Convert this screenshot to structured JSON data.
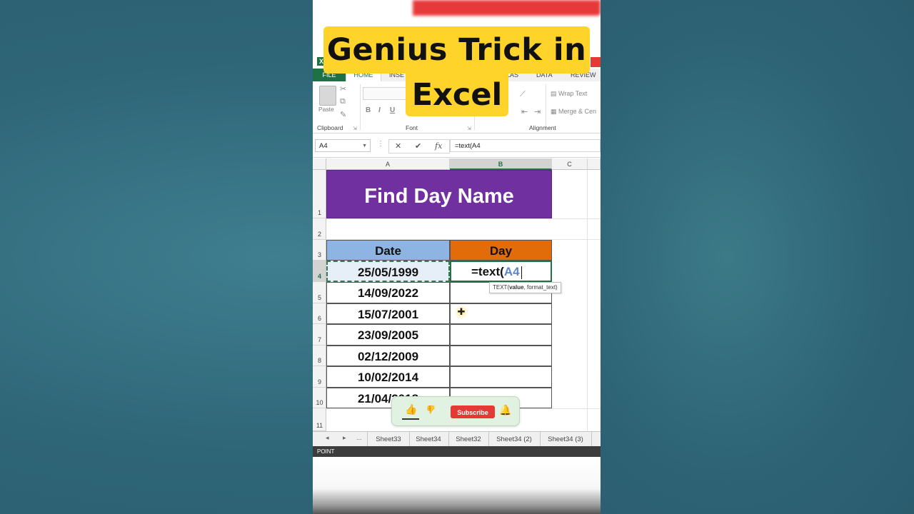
{
  "title": {
    "line1": "Genius Trick in",
    "line2": "Excel"
  },
  "excel": {
    "ribbon_tabs": [
      "FILE",
      "HOME",
      "INSE",
      "LAS",
      "DATA",
      "REVIEW"
    ],
    "ribbon": {
      "paste_label": "Paste",
      "clipboard_label": "Clipboard",
      "font_label": "Font",
      "alignment_label": "Alignment",
      "wrap_text": "Wrap Text",
      "merge_center": "Merge & Cen",
      "bold": "B",
      "italic": "I",
      "underline": "U"
    },
    "name_box": "A4",
    "formula": "=text(A4",
    "columns": [
      "A",
      "B",
      "C"
    ],
    "rows": [
      "1",
      "2",
      "3",
      "4",
      "5",
      "6",
      "7",
      "8",
      "9",
      "10",
      "11"
    ],
    "banner": "Find Day Name",
    "headers": {
      "date": "Date",
      "day": "Day"
    },
    "dates": [
      "25/05/1999",
      "14/09/2022",
      "15/07/2001",
      "23/09/2005",
      "02/12/2009",
      "10/02/2014",
      "21/04/2018"
    ],
    "b4": {
      "prefix": "=text(",
      "ref": "A4"
    },
    "tooltip": {
      "fn": "TEXT(",
      "arg1": "value",
      "rest": ", format_text)"
    },
    "sheet_nav": {
      "prev": "◂",
      "next": "▸",
      "more": "..."
    },
    "sheets": [
      "Sheet33",
      "Sheet34",
      "Sheet32",
      "Sheet34 (2)",
      "Sheet34 (3)"
    ],
    "status": "POINT"
  },
  "subscribe_pill": {
    "subscribe_label": "Subscribe",
    "icons": [
      "thumbs-up-icon",
      "thumbs-down-icon",
      "bell-icon"
    ]
  },
  "colors": {
    "title_bg": "#ffd42a",
    "banner": "#7030a0",
    "date_header": "#8db4e2",
    "day_header": "#e26b0a",
    "excel_green": "#217346",
    "subscribe_red": "#e53935"
  }
}
